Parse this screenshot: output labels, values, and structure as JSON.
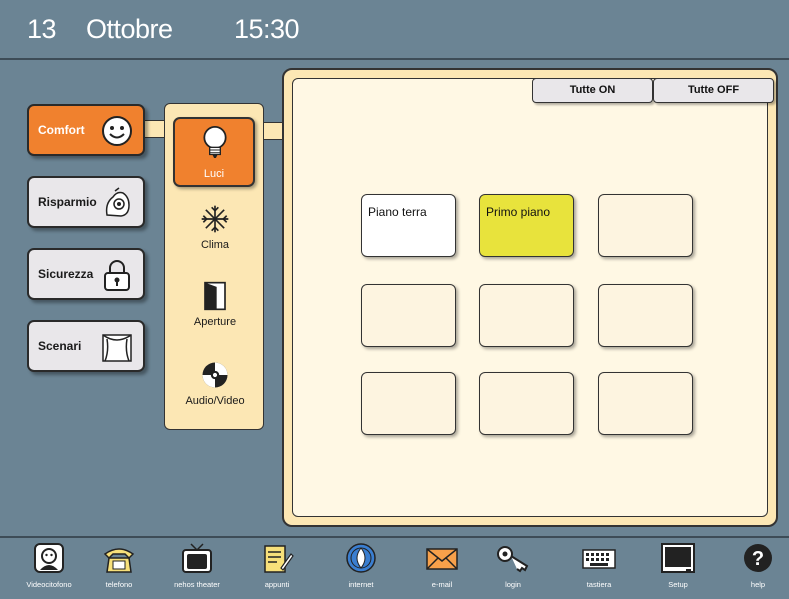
{
  "header": {
    "day": "13",
    "month": "Ottobre",
    "time": "15:30"
  },
  "categories": [
    {
      "label": "Comfort",
      "icon": "smiley-icon",
      "active": true
    },
    {
      "label": "Risparmio",
      "icon": "piggy-bank-icon",
      "active": false
    },
    {
      "label": "Sicurezza",
      "icon": "padlock-icon",
      "active": false
    },
    {
      "label": "Scenari",
      "icon": "theater-curtain-icon",
      "active": false
    }
  ],
  "subcategories": [
    {
      "label": "Luci",
      "icon": "lightbulb-icon",
      "active": true
    },
    {
      "label": "Clima",
      "icon": "snowflake-icon"
    },
    {
      "label": "Aperture",
      "icon": "door-icon"
    },
    {
      "label": "Audio/Video",
      "icon": "cd-icon"
    }
  ],
  "actions": {
    "all_on": "Tutte ON",
    "all_off": "Tutte OFF"
  },
  "rooms": [
    {
      "label": "Piano terra",
      "state": "white"
    },
    {
      "label": "Primo piano",
      "state": "yellow"
    },
    {
      "label": "",
      "state": "empty"
    },
    {
      "label": "",
      "state": "empty"
    },
    {
      "label": "",
      "state": "empty"
    },
    {
      "label": "",
      "state": "empty"
    },
    {
      "label": "",
      "state": "empty"
    },
    {
      "label": "",
      "state": "empty"
    },
    {
      "label": "",
      "state": "empty"
    }
  ],
  "bottom_bar": [
    {
      "label": "Videocitofono",
      "icon": "intercom-icon"
    },
    {
      "label": "telefono",
      "icon": "phone-icon"
    },
    {
      "label": "nehos theater",
      "icon": "tv-icon"
    },
    {
      "label": "appunti",
      "icon": "notepad-icon"
    },
    {
      "label": "internet",
      "icon": "globe-icon"
    },
    {
      "label": "e-mail",
      "icon": "envelope-icon"
    },
    {
      "label": "login",
      "icon": "key-icon"
    },
    {
      "label": "tastiera",
      "icon": "keyboard-icon"
    },
    {
      "label": "Setup",
      "icon": "monitor-icon"
    },
    {
      "label": "help",
      "icon": "help-icon"
    }
  ],
  "colors": {
    "background": "#6b8494",
    "accent": "#f0812e",
    "panel": "#fce7b4",
    "selected_room": "#e8e33c"
  }
}
